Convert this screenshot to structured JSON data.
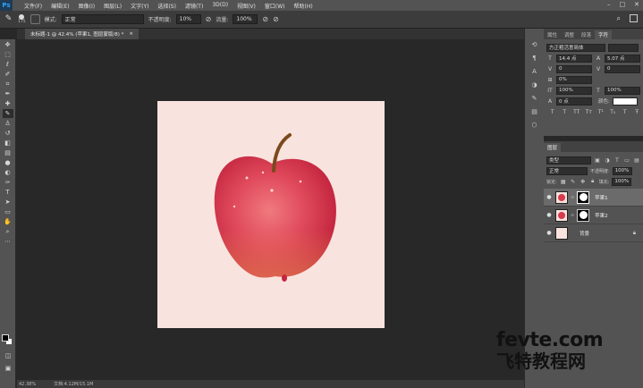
{
  "app": {
    "logo": "Ps"
  },
  "menu": [
    "文件(F)",
    "编辑(E)",
    "图像(I)",
    "图层(L)",
    "文字(Y)",
    "选择(S)",
    "滤镜(T)",
    "3D(D)",
    "视图(V)",
    "窗口(W)",
    "帮助(H)"
  ],
  "window_controls": [
    "–",
    "□",
    "✕"
  ],
  "options": {
    "brush_size": "175",
    "mode_label": "模式:",
    "mode_value": "正常",
    "opacity_label": "不透明度:",
    "opacity_value": "10%",
    "flow_label": "流量:",
    "flow_value": "100%"
  },
  "document_tab": {
    "title": "未标题-1 @ 42.4% (苹果1, 图层蒙版/8) *",
    "close": "×"
  },
  "status": {
    "zoom": "42.38%",
    "doc_size": "文档:4.12M/15.1M"
  },
  "character_panel": {
    "tabs": [
      "属性",
      "调整",
      "段落",
      "字符"
    ],
    "font_family": "方正粗活意简体",
    "font_size": "14.4 点",
    "leading": "5.07 点",
    "kerning": "0",
    "tracking": "0",
    "scale_pct": "0%",
    "vscale": "100%",
    "hscale": "100%",
    "baseline": "0 点",
    "color_label": "颜色:"
  },
  "layers_panel": {
    "tab": "图层",
    "filter_kind": "类型",
    "blend_mode": "正常",
    "opacity_label": "不透明度:",
    "opacity_value": "100%",
    "lock_label": "锁定:",
    "fill_label": "填充:",
    "fill_value": "100%",
    "layers": [
      {
        "name": "苹果1",
        "selected": true
      },
      {
        "name": "苹果2",
        "selected": false
      },
      {
        "name": "背景",
        "selected": false
      }
    ]
  },
  "watermark": {
    "line1": "fevte.com",
    "line2": "飞特教程网"
  },
  "colors": {
    "canvas_bg": "#f9e3de",
    "apple_red": "#d83a4e",
    "workspace": "#282828"
  }
}
